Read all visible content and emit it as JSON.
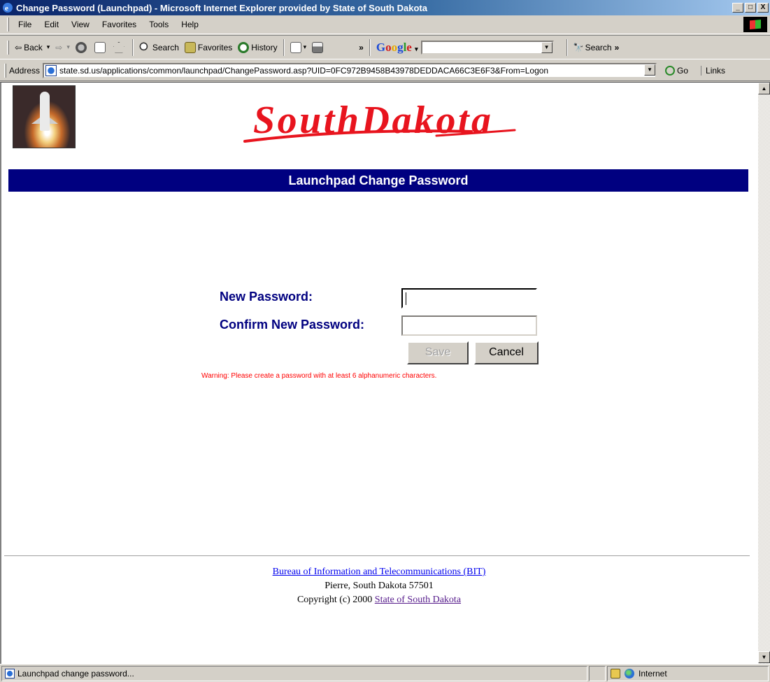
{
  "window": {
    "title": "Change Password (Launchpad) - Microsoft Internet Explorer provided by State of South Dakota",
    "controls": [
      "_",
      "□",
      "X"
    ]
  },
  "menu": [
    "File",
    "Edit",
    "View",
    "Favorites",
    "Tools",
    "Help"
  ],
  "toolbar": {
    "back": "Back",
    "search": "Search",
    "favorites": "Favorites",
    "history": "History",
    "chevron": "»",
    "google_search": "Search",
    "google_logo": [
      "G",
      "o",
      "o",
      "g",
      "l",
      "e"
    ]
  },
  "address": {
    "label": "Address",
    "url": "state.sd.us/applications/common/launchpad/ChangePassword.asp?UID=0FC972B9458B43978DEDDACA66C3E6F3&From=Logon",
    "go": "Go",
    "links": "Links"
  },
  "page": {
    "logo_text": "SouthDakota",
    "banner": "Launchpad Change Password",
    "form": {
      "new_password_label": "New Password:",
      "confirm_password_label": "Confirm New Password:",
      "new_password_value": "",
      "confirm_password_value": "",
      "save_label": "Save",
      "cancel_label": "Cancel",
      "warning": "Warning: Please create a password with at least 6 alphanumeric characters."
    },
    "footer": {
      "bureau_link": "Bureau of Information and Telecommunications (BIT)",
      "address_line": "Pierre, South Dakota 57501",
      "copyright": "Copyright (c) 2000 ",
      "state_link": "State of South Dakota"
    }
  },
  "status": {
    "text": "Launchpad change password...",
    "zone": "Internet"
  },
  "colors": {
    "banner_bg": "#000080",
    "label_color": "#000080",
    "warning_color": "#ff0000",
    "logo_red": "#e8141e"
  }
}
